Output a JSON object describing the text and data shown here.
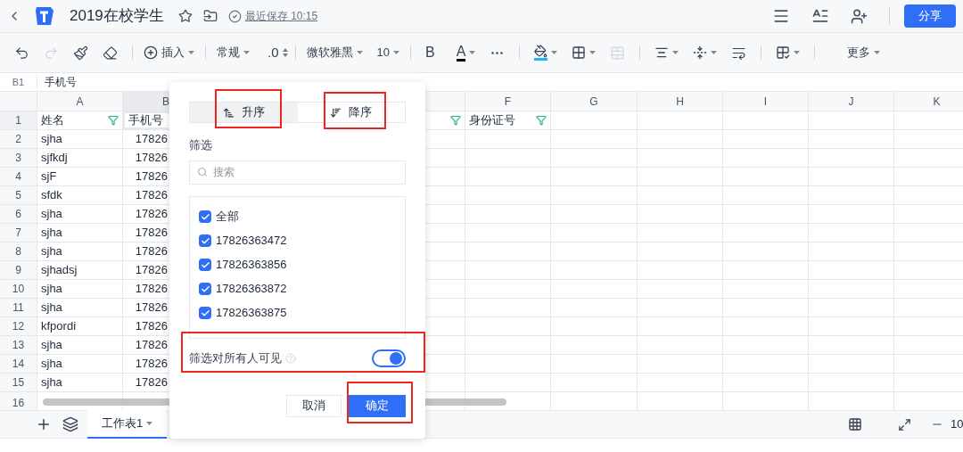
{
  "titlebar": {
    "title": "2019在校学生",
    "save_status": "最近保存 10:15",
    "share": "分享"
  },
  "toolbar": {
    "redo_disabled": true,
    "insert": "插入",
    "number_format": "常规",
    "decimal": ".0",
    "font": "微软雅黑",
    "font_size": "10",
    "bold": "B",
    "font_color": "A",
    "merge_disabled": true,
    "more": "更多"
  },
  "formula_bar": {
    "cell": "B1",
    "value": "手机号"
  },
  "grid": {
    "left_columns": [
      "A",
      "B"
    ],
    "right_columns": [
      "F",
      "G",
      "H",
      "I",
      "J",
      "K"
    ],
    "header_cells": [
      {
        "text": "姓名",
        "filter": true,
        "selected": false
      },
      {
        "text": "手机号",
        "selected": true
      },
      {
        "filter": true,
        "selected": false
      },
      {
        "text": "身份证号",
        "filter": true,
        "selected": false
      }
    ],
    "header_number": "1",
    "rows": [
      {
        "number": "2",
        "name": "sjha",
        "phone": "17826"
      },
      {
        "number": "3",
        "name": "sjfkdj",
        "phone": "17826"
      },
      {
        "number": "4",
        "name": "sjF",
        "phone": "17826"
      },
      {
        "number": "5",
        "name": "sfdk",
        "phone": "17826"
      },
      {
        "number": "6",
        "name": "sjha",
        "phone": "17826"
      },
      {
        "number": "7",
        "name": "sjha",
        "phone": "17826"
      },
      {
        "number": "8",
        "name": "sjha",
        "phone": "17826"
      },
      {
        "number": "9",
        "name": "sjhadsj",
        "phone": "17826"
      },
      {
        "number": "10",
        "name": "sjha",
        "phone": "17826"
      },
      {
        "number": "11",
        "name": "sjha",
        "phone": "17826"
      },
      {
        "number": "12",
        "name": "kfpordi",
        "phone": "17826"
      },
      {
        "number": "13",
        "name": "sjha",
        "phone": "17826"
      },
      {
        "number": "14",
        "name": "sjha",
        "phone": "17826"
      },
      {
        "number": "15",
        "name": "sjha",
        "phone": "17826"
      }
    ],
    "partial_row": {
      "number": "16"
    }
  },
  "sheet_tabs": [
    {
      "label": "工作表1",
      "selected": true
    }
  ],
  "zoom_level": "10",
  "filter_dialog": {
    "sort_options": [
      {
        "label": "升序",
        "selected": true
      },
      {
        "label": "降序",
        "selected": false
      }
    ],
    "filter_label": "筛选",
    "search": {
      "placeholder": "搜索"
    },
    "values": [
      {
        "label": "全部",
        "checked": true
      },
      {
        "label": "17826363472",
        "checked": true
      },
      {
        "label": "17826363856",
        "checked": true
      },
      {
        "label": "17826363872",
        "checked": true
      },
      {
        "label": "17826363875",
        "checked": true
      }
    ],
    "visibility": {
      "label": "筛选对所有人可见",
      "on": true
    },
    "buttons": {
      "cancel": "取消",
      "confirm": "确定"
    }
  }
}
